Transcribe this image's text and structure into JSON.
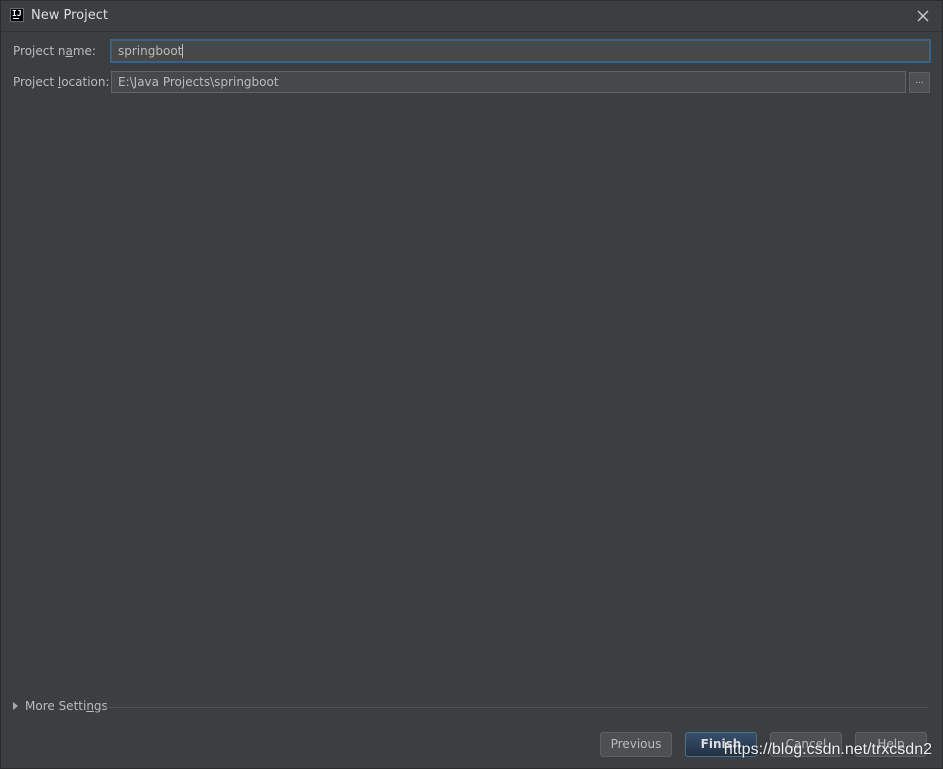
{
  "window": {
    "title": "New Project",
    "app_icon_text": "IJ"
  },
  "form": {
    "project_name_label_pre": "Project n",
    "project_name_label_mnemonic": "a",
    "project_name_label_post": "me:",
    "project_name_value": "springboot",
    "project_location_label_pre": "Project ",
    "project_location_label_mnemonic": "l",
    "project_location_label_post": "ocation:",
    "project_location_value": "E:\\Java Projects\\springboot",
    "browse_label": "..."
  },
  "more_settings": {
    "label_pre": "More Setti",
    "label_mnemonic": "n",
    "label_post": "gs"
  },
  "buttons": {
    "previous": "Previous",
    "finish": "Finish",
    "cancel": "Cancel",
    "help": "Help"
  },
  "watermark": "https://blog.csdn.net/trxcsdn2",
  "colors": {
    "background": "#3c3f41",
    "input_background": "#45494a",
    "focus_border": "#3d6185",
    "text": "#bbbbbb"
  }
}
